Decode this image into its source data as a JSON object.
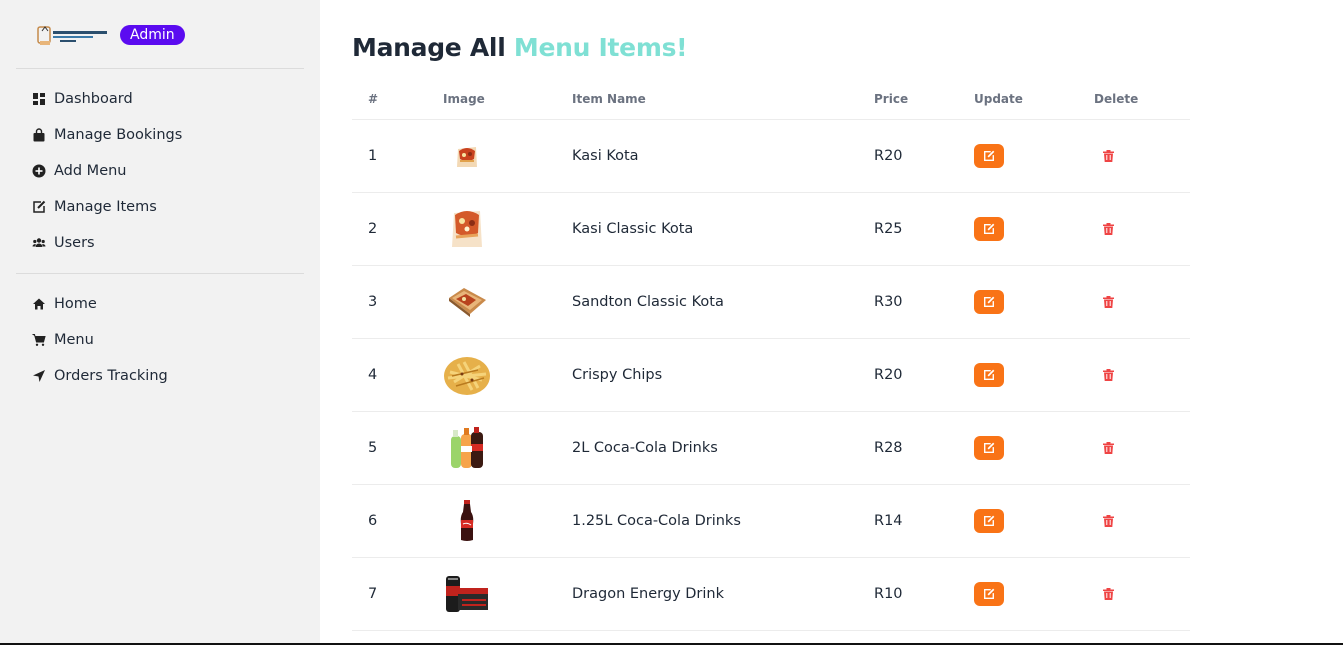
{
  "sidebar": {
    "logo_name": "restaurant-logo",
    "badge": "Admin",
    "admin_items": [
      {
        "label": "Dashboard",
        "icon": "dashboard-icon"
      },
      {
        "label": "Manage Bookings",
        "icon": "shopping-bag-icon"
      },
      {
        "label": "Add Menu",
        "icon": "plus-circle-icon"
      },
      {
        "label": "Manage Items",
        "icon": "edit-icon"
      },
      {
        "label": "Users",
        "icon": "users-icon"
      }
    ],
    "site_items": [
      {
        "label": "Home",
        "icon": "home-icon"
      },
      {
        "label": "Menu",
        "icon": "cart-icon"
      },
      {
        "label": "Orders Tracking",
        "icon": "location-arrow-icon"
      }
    ]
  },
  "main": {
    "title_prefix": "Manage All",
    "title_accent": "Menu Items!",
    "accent_color": "#7fe0d4",
    "columns": [
      "#",
      "Image",
      "Item Name",
      "Price",
      "Update",
      "Delete"
    ],
    "rows": [
      {
        "num": "1",
        "name": "Kasi Kota",
        "price": "R20",
        "image": "kota-image"
      },
      {
        "num": "2",
        "name": "Kasi Classic Kota",
        "price": "R25",
        "image": "kota-image"
      },
      {
        "num": "3",
        "name": "Sandton Classic Kota",
        "price": "R30",
        "image": "kota-box-image"
      },
      {
        "num": "4",
        "name": "Crispy Chips",
        "price": "R20",
        "image": "chips-image"
      },
      {
        "num": "5",
        "name": "2L Coca-Cola Drinks",
        "price": "R28",
        "image": "soda-bottles-image"
      },
      {
        "num": "6",
        "name": "1.25L Coca-Cola Drinks",
        "price": "R14",
        "image": "coke-bottle-image"
      },
      {
        "num": "7",
        "name": "Dragon Energy Drink",
        "price": "R10",
        "image": "energy-drink-image"
      }
    ],
    "update_color": "#f97316",
    "delete_color": "#ef4444"
  }
}
